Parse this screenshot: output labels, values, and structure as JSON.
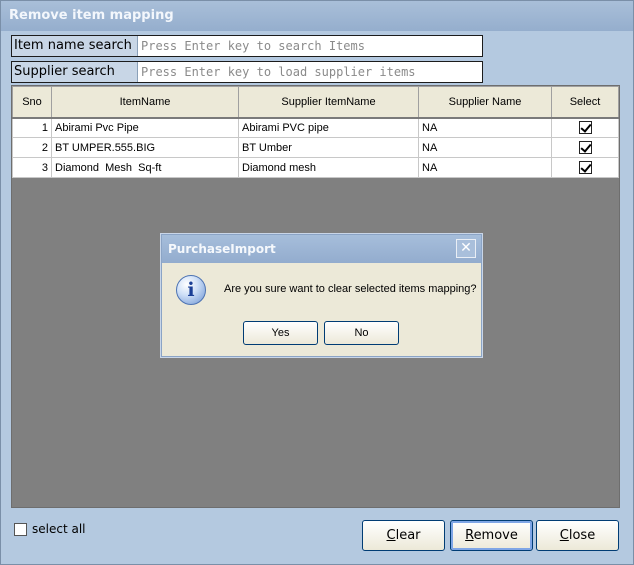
{
  "window": {
    "title": "Remove item mapping"
  },
  "search": {
    "item_label": "Item name search",
    "item_placeholder": "Press Enter key to search Items",
    "supplier_label": "Supplier search",
    "supplier_placeholder": "Press Enter key to load supplier items"
  },
  "grid": {
    "columns": [
      "Sno",
      "ItemName",
      "Supplier ItemName",
      "Supplier Name",
      "Select"
    ],
    "rows": [
      {
        "sno": "1",
        "item": "Abirami Pvc Pipe",
        "supplier_item": "Abirami PVC pipe",
        "supplier": "NA",
        "selected": true
      },
      {
        "sno": "2",
        "item": "BT UMPER.555.BIG",
        "supplier_item": "BT Umber",
        "supplier": "NA",
        "selected": true
      },
      {
        "sno": "3",
        "item": "Diamond  Mesh  Sq-ft",
        "supplier_item": "Diamond mesh",
        "supplier": "NA",
        "selected": true
      }
    ]
  },
  "dialog": {
    "title": "PurchaseImport",
    "icon": "info-icon",
    "message": "Are you sure want to clear selected items mapping?",
    "yes_label": "Yes",
    "no_label": "No",
    "close_glyph": "✕"
  },
  "footer": {
    "select_all_label": "select all",
    "clear": {
      "mnemonic": "C",
      "rest": "lear"
    },
    "remove": {
      "mnemonic": "R",
      "rest": "emove"
    },
    "close": {
      "mnemonic": "C",
      "rest": "lose"
    }
  },
  "colors": {
    "window_bg": "#b4c9e0",
    "grid_bg": "#808080",
    "dialog_bg": "#ece9d8"
  }
}
